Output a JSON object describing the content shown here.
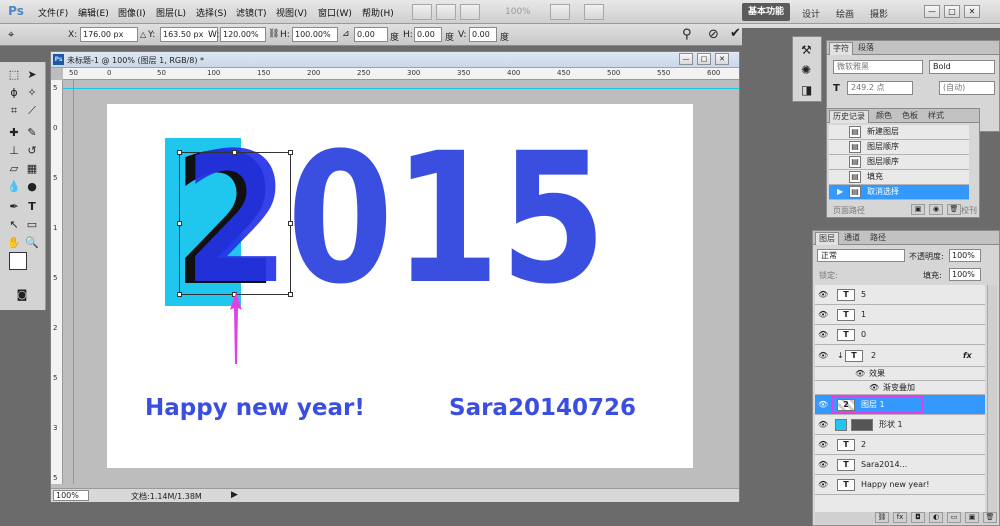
{
  "menubar": {
    "logo": "Ps",
    "items": [
      "文件(F)",
      "编辑(E)",
      "图像(I)",
      "图层(L)",
      "选择(S)",
      "滤镜(T)",
      "视图(V)",
      "窗口(W)",
      "帮助(H)"
    ],
    "zoom": "100%",
    "workspace_active": "基本功能",
    "workspaces": [
      "设计",
      "绘画",
      "摄影"
    ],
    "win_min": "—",
    "win_max": "□",
    "win_close": "✕"
  },
  "options": {
    "x_label": "X:",
    "x_value": "176.00 px",
    "y_label": "Y:",
    "y_value": "163.50 px",
    "w_label": "W:",
    "w_value": "120.00%",
    "h_label": "H:",
    "h_value": "100.00%",
    "rot_value": "0.00",
    "rot_unit": "度",
    "hskew_label": "H:",
    "hskew_value": "0.00",
    "hskew_unit": "度",
    "vskew_label": "V:",
    "vskew_value": "0.00",
    "vskew_unit": "度"
  },
  "document": {
    "title": "未标题-1 @ 100% (图层 1, RGB/8) *",
    "ruler_h": [
      "50",
      "0",
      "50",
      "100",
      "150",
      "200",
      "250",
      "300",
      "350",
      "400",
      "450",
      "500",
      "550",
      "600",
      "650"
    ],
    "ruler_v": [
      "5",
      "0",
      "5",
      "1",
      "5",
      "2",
      "5",
      "3",
      "5"
    ],
    "zoom_status": "100%",
    "doc_info": "文档:1.14M/1.38M",
    "big_year_first": "2",
    "big_year_rest": "015",
    "greeting": "Happy new year!",
    "signature": "Sara20140726"
  },
  "char_panel": {
    "tabs": [
      "字符",
      "段落"
    ],
    "font_family": "微软雅黑",
    "font_style": "Bold",
    "font_size": "249.2 点",
    "leading": "(自动)"
  },
  "history_panel": {
    "tabs": [
      "历史记录",
      "颜色",
      "色板",
      "样式"
    ],
    "items": [
      "新建图层",
      "图层顺序",
      "图层顺序",
      "填充",
      "取消选择"
    ],
    "selected_index": 4,
    "partial_left": "页面路径",
    "partial_right": "校刊"
  },
  "layers_panel": {
    "tabs": [
      "图层",
      "通道",
      "路径"
    ],
    "blend_mode": "正常",
    "opacity_label": "不透明度:",
    "opacity_value": "100%",
    "lock_label": "锁定:",
    "fill_label": "填充:",
    "fill_value": "100%",
    "layers": [
      {
        "name": "5",
        "thumb": "T"
      },
      {
        "name": "1",
        "thumb": "T"
      },
      {
        "name": "0",
        "thumb": "T"
      },
      {
        "name": "2",
        "thumb": "T",
        "fx": "fx"
      },
      {
        "name": "效果",
        "thumb": ""
      },
      {
        "name": "渐变叠加",
        "thumb": ""
      },
      {
        "name": "图层 1",
        "thumb": "2"
      },
      {
        "name": "形状 1",
        "thumb": ""
      },
      {
        "name": "2",
        "thumb": "T"
      },
      {
        "name": "Sara2014...",
        "thumb": "T"
      },
      {
        "name": "Happy new year!",
        "thumb": "T"
      }
    ],
    "selected_index": 6
  },
  "colors": {
    "blue_text": "#3a4fe0",
    "cyan_rect": "#1fc7ef",
    "highlight": "#3399ff",
    "arrow": "#e040e8"
  }
}
